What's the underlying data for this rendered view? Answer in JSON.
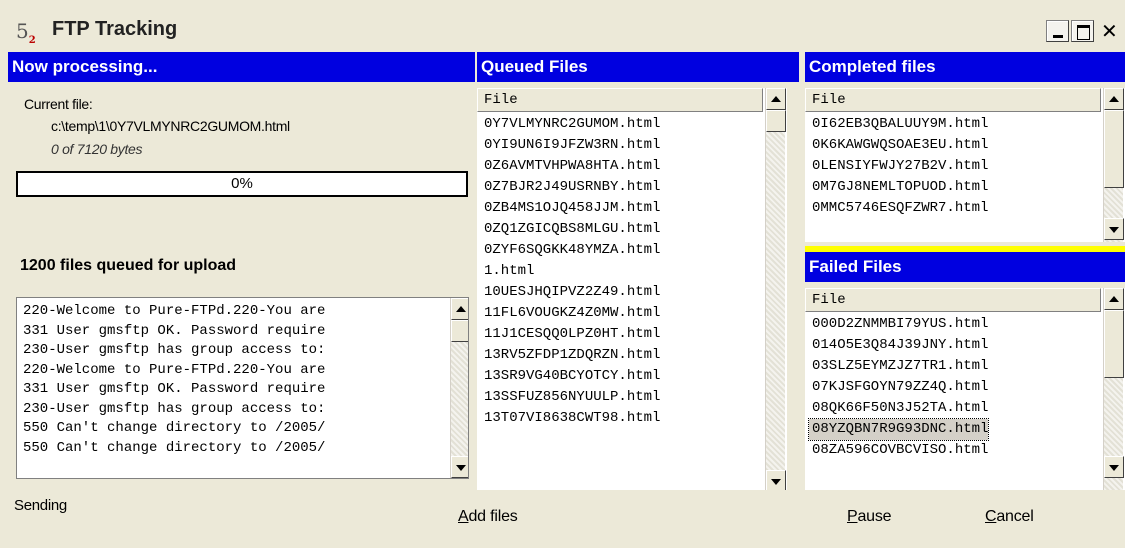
{
  "window": {
    "title": "FTP Tracking",
    "icon": "app-icon-5-2",
    "icon_glyph": "5",
    "icon_sub": "2"
  },
  "now_processing": {
    "header": "Now processing...",
    "current_label": "Current file:",
    "current_path": "c:\\temp\\1\\0Y7VLMYNRC2GUMOM.html",
    "bytes_text": "0 of 7120 bytes",
    "progress_percent": 0,
    "progress_text": "0%",
    "queued_count_text": "1200 files queued for upload",
    "log": [
      "220-Welcome to Pure-FTPd.220-You are",
      "331 User gmsftp OK. Password require",
      "230-User gmsftp has group access to:",
      "220-Welcome to Pure-FTPd.220-You are",
      "331 User gmsftp OK. Password require",
      "230-User gmsftp has group access to:",
      "550 Can't change directory to /2005/",
      "550 Can't change directory to /2005/"
    ]
  },
  "queued": {
    "header": "Queued Files",
    "column": "File",
    "files": [
      "0Y7VLMYNRC2GUMOM.html",
      "0YI9UN6I9JFZW3RN.html",
      "0Z6AVMTVHPWA8HTA.html",
      "0Z7BJR2J49USRNBY.html",
      "0ZB4MS1OJQ458JJM.html",
      "0ZQ1ZGICQBS8MLGU.html",
      "0ZYF6SQGKK48YMZA.html",
      "1.html",
      "10UESJHQIPVZ2Z49.html",
      "11FL6VOUGKZ4Z0MW.html",
      "11J1CESQQ0LPZ0HT.html",
      "13RV5ZFDP1ZDQRZN.html",
      "13SR9VG40BCYOTCY.html",
      "13SSFUZ856NYUULP.html",
      "13T07VI8638CWT98.html"
    ]
  },
  "completed": {
    "header": "Completed files",
    "column": "File",
    "files": [
      "0I62EB3QBALUUY9M.html",
      "0K6KAWGWQSOAE3EU.html",
      "0LENSIYFWJY27B2V.html",
      "0M7GJ8NEMLTOPUOD.html",
      "0MMC5746ESQFZWR7.html"
    ]
  },
  "failed": {
    "header": "Failed Files",
    "column": "File",
    "files": [
      "000D2ZNMMBI79YUS.html",
      "014O5E3Q84J39JNY.html",
      "03SLZ5EYMZJZ7TR1.html",
      "07KJSFGOYN79ZZ4Q.html",
      "08QK66F50N3J52TA.html",
      "08YZQBN7R9G93DNC.html",
      "08ZA596COVBCVISO.html"
    ],
    "selected_index": 5
  },
  "status": "Sending",
  "buttons": {
    "add_files": {
      "accel": "A",
      "rest": "dd files"
    },
    "pause": {
      "accel": "P",
      "rest": "ause"
    },
    "cancel": {
      "accel": "C",
      "rest": "ancel"
    }
  },
  "colors": {
    "header_bg": "#0000e0",
    "separator": "#ffff00",
    "window_bg": "#ece9d8"
  }
}
